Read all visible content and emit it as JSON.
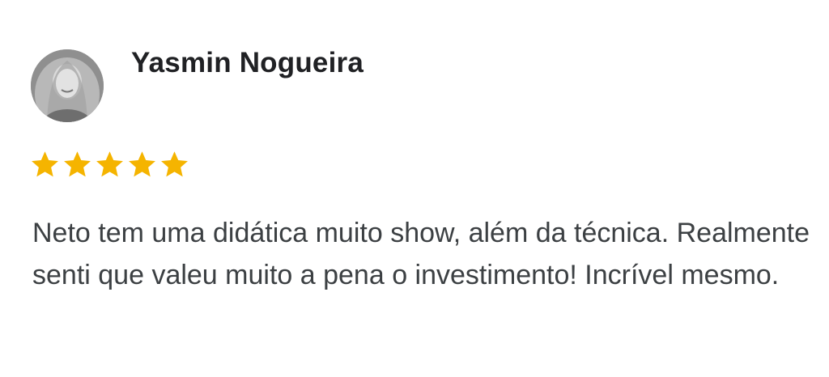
{
  "review": {
    "reviewer_name": "Yasmin Nogueira",
    "avatar_icon": "user-avatar-photo",
    "rating": 5,
    "rating_max": 5,
    "star_color": "#F5B400",
    "text": "Neto tem uma didática muito show, além da técnica. Realmente senti que valeu muito a pena o investimento! Incrível mesmo."
  }
}
